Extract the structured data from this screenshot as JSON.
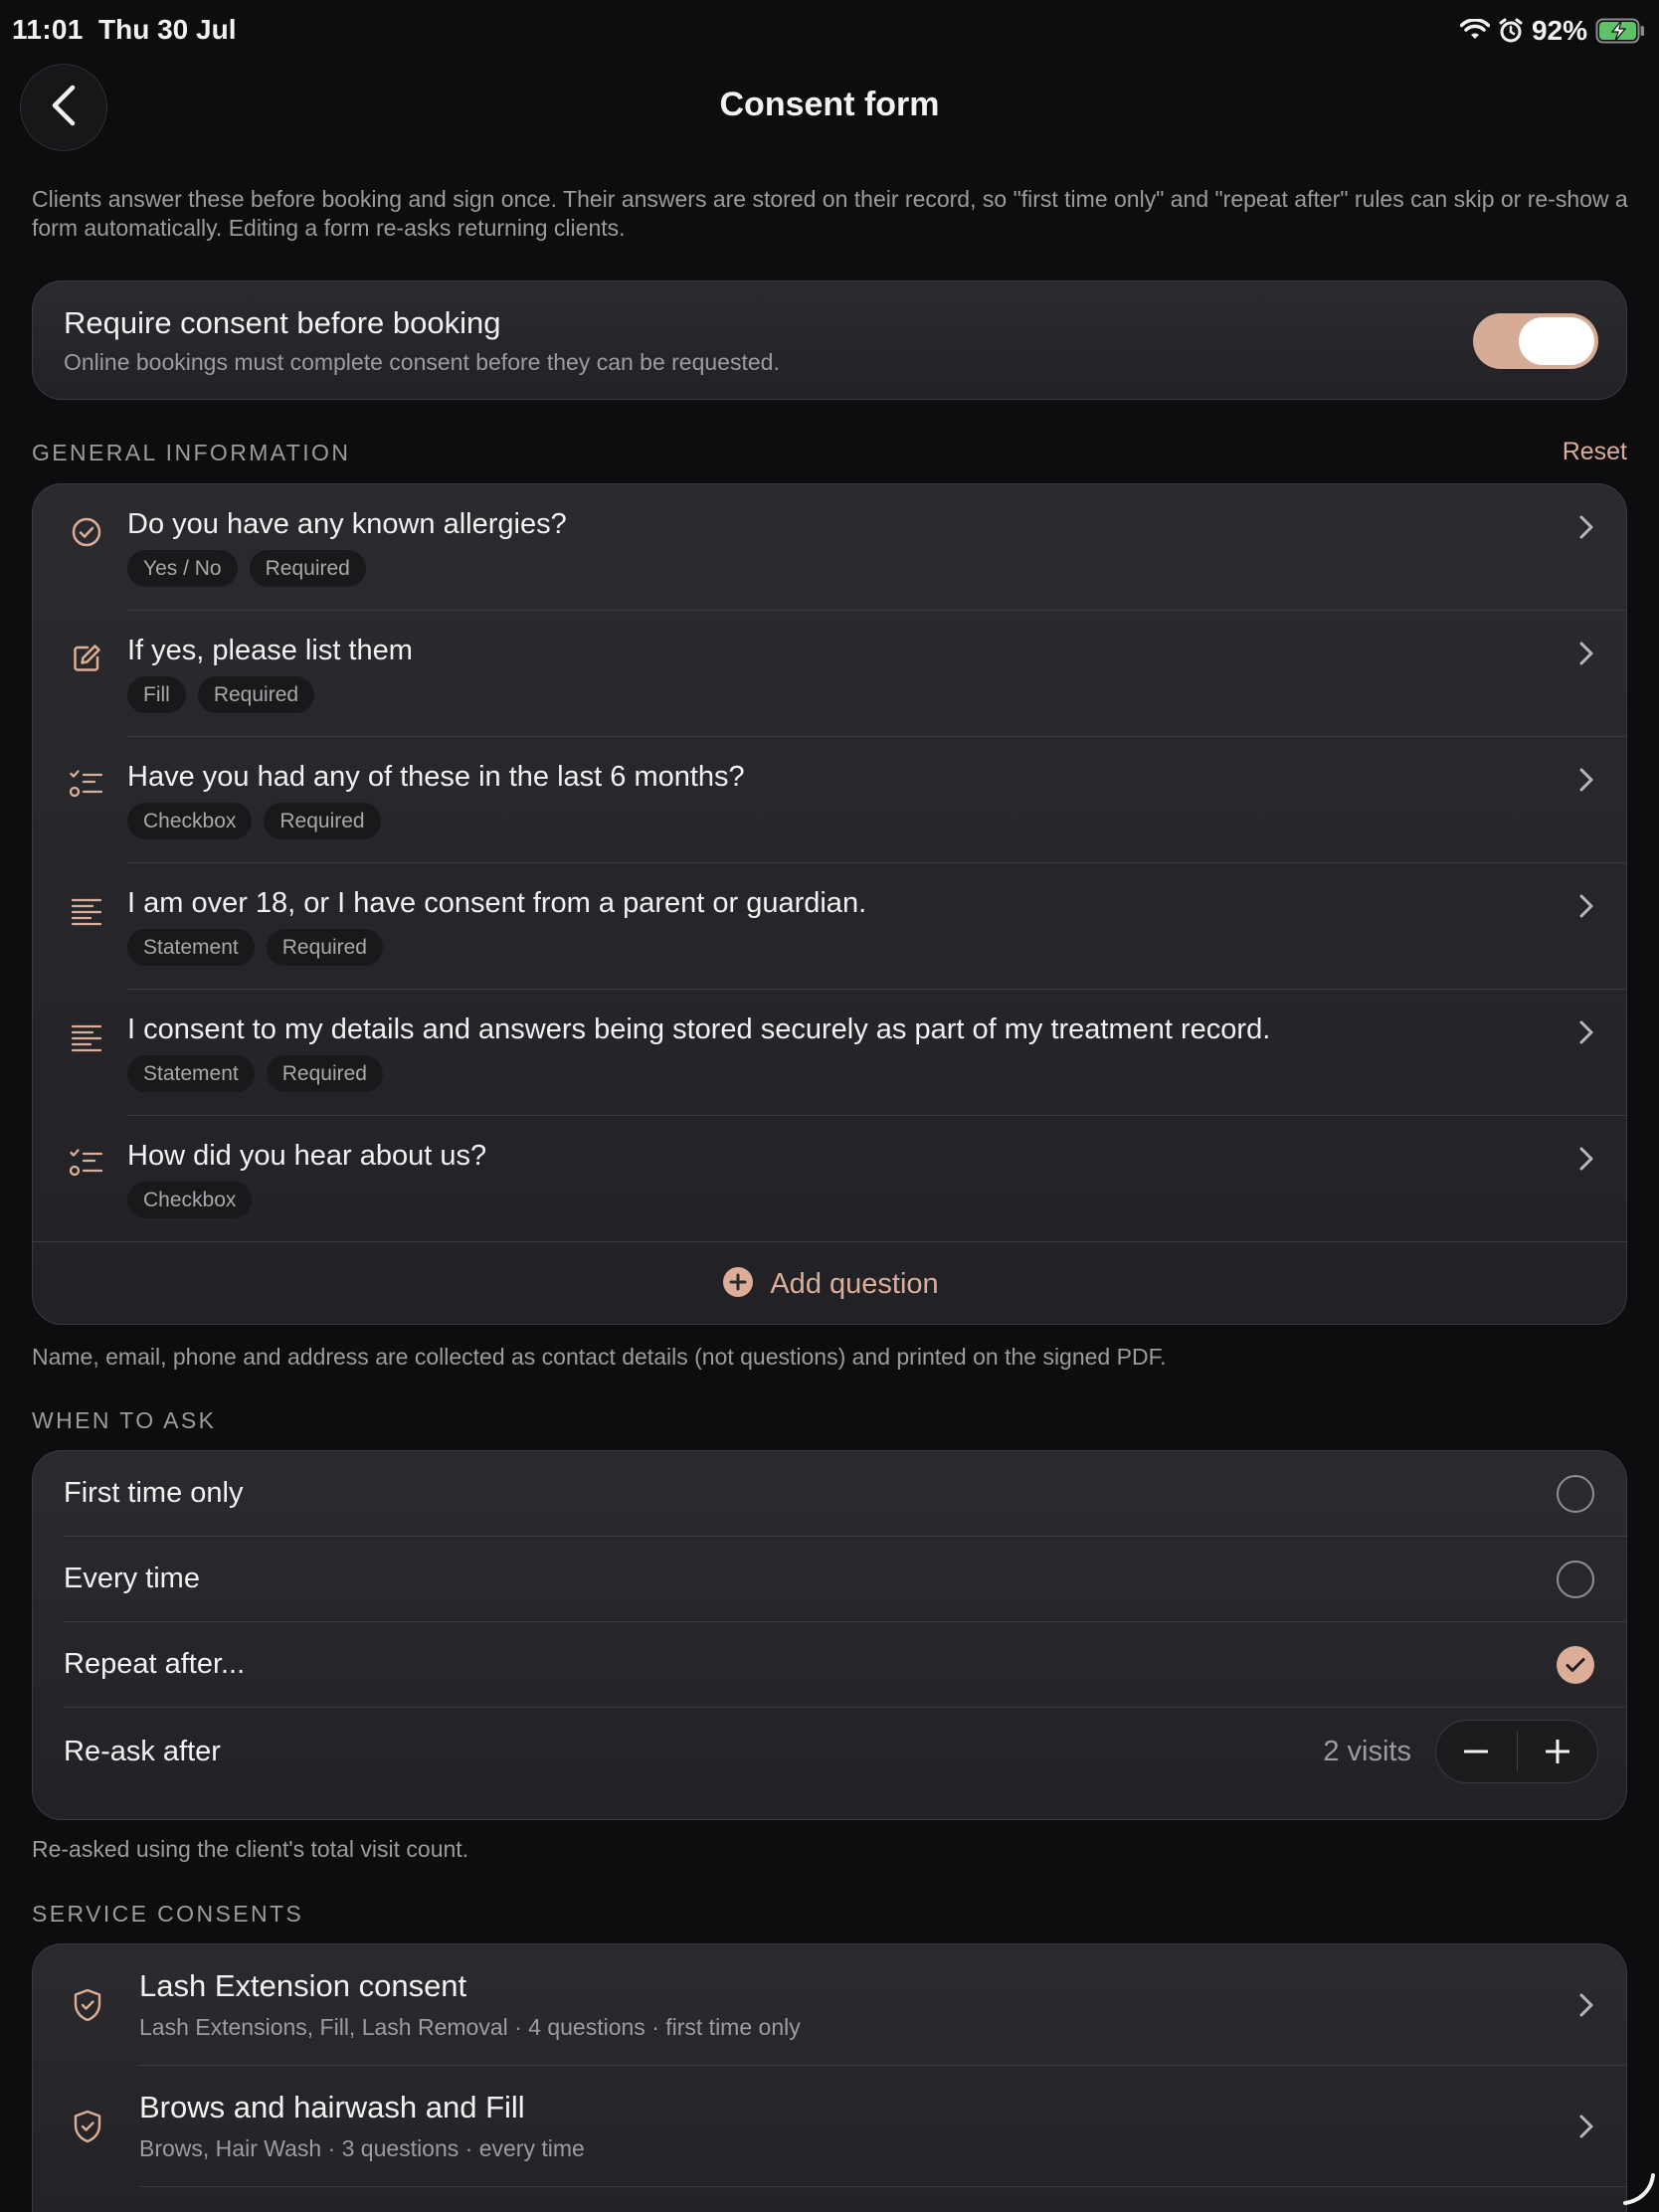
{
  "status_bar": {
    "time": "11:01",
    "date": "Thu 30 Jul",
    "battery_percent": "92%"
  },
  "nav": {
    "title": "Consent form"
  },
  "intro_text": "Clients answer these before booking and sign once. Their answers are stored on their record, so \"first time only\" and \"repeat after\" rules can skip or re-show a form automatically. Editing a form re-asks returning clients.",
  "require_consent": {
    "title": "Require consent before booking",
    "subtitle": "Online bookings must complete consent before they can be requested.",
    "enabled": true
  },
  "general_info": {
    "header": "GENERAL INFORMATION",
    "reset_label": "Reset",
    "questions": [
      {
        "icon": "check-circle-icon",
        "text": "Do you have any known allergies?",
        "tags": [
          "Yes / No",
          "Required"
        ]
      },
      {
        "icon": "edit-icon",
        "text": "If yes, please list them",
        "tags": [
          "Fill",
          "Required"
        ]
      },
      {
        "icon": "checklist-icon",
        "text": "Have you had any of these in the last 6 months?",
        "tags": [
          "Checkbox",
          "Required"
        ]
      },
      {
        "icon": "text-lines-icon",
        "text": "I am over 18, or I have consent from a parent or guardian.",
        "tags": [
          "Statement",
          "Required"
        ]
      },
      {
        "icon": "text-lines-icon",
        "text": "I consent to my details and answers being stored securely as part of my treatment record.",
        "tags": [
          "Statement",
          "Required"
        ]
      },
      {
        "icon": "checklist-icon",
        "text": "How did you hear about us?",
        "tags": [
          "Checkbox"
        ]
      }
    ],
    "add_label": "Add question",
    "footnote": "Name, email, phone and address are collected as contact details (not questions) and printed on the signed PDF."
  },
  "when_to_ask": {
    "header": "WHEN TO ASK",
    "options": [
      {
        "label": "First time only",
        "selected": false
      },
      {
        "label": "Every time",
        "selected": false
      },
      {
        "label": "Repeat after...",
        "selected": true
      }
    ],
    "reask_label": "Re-ask after",
    "reask_value": "2 visits",
    "footnote": "Re-asked using the client's total visit count."
  },
  "service_consents": {
    "header": "SERVICE CONSENTS",
    "items": [
      {
        "title": "Lash Extension consent",
        "subtitle": "Lash Extensions, Fill, Lash Removal · 4 questions · first time only"
      },
      {
        "title": "Brows and hairwash and Fill",
        "subtitle": "Brows, Hair Wash · 3 questions · every time"
      }
    ]
  },
  "colors": {
    "accent": "#dcae97",
    "background": "#0d0d0f",
    "card": "#2b2b2f",
    "muted_text": "#9c9c9e"
  }
}
